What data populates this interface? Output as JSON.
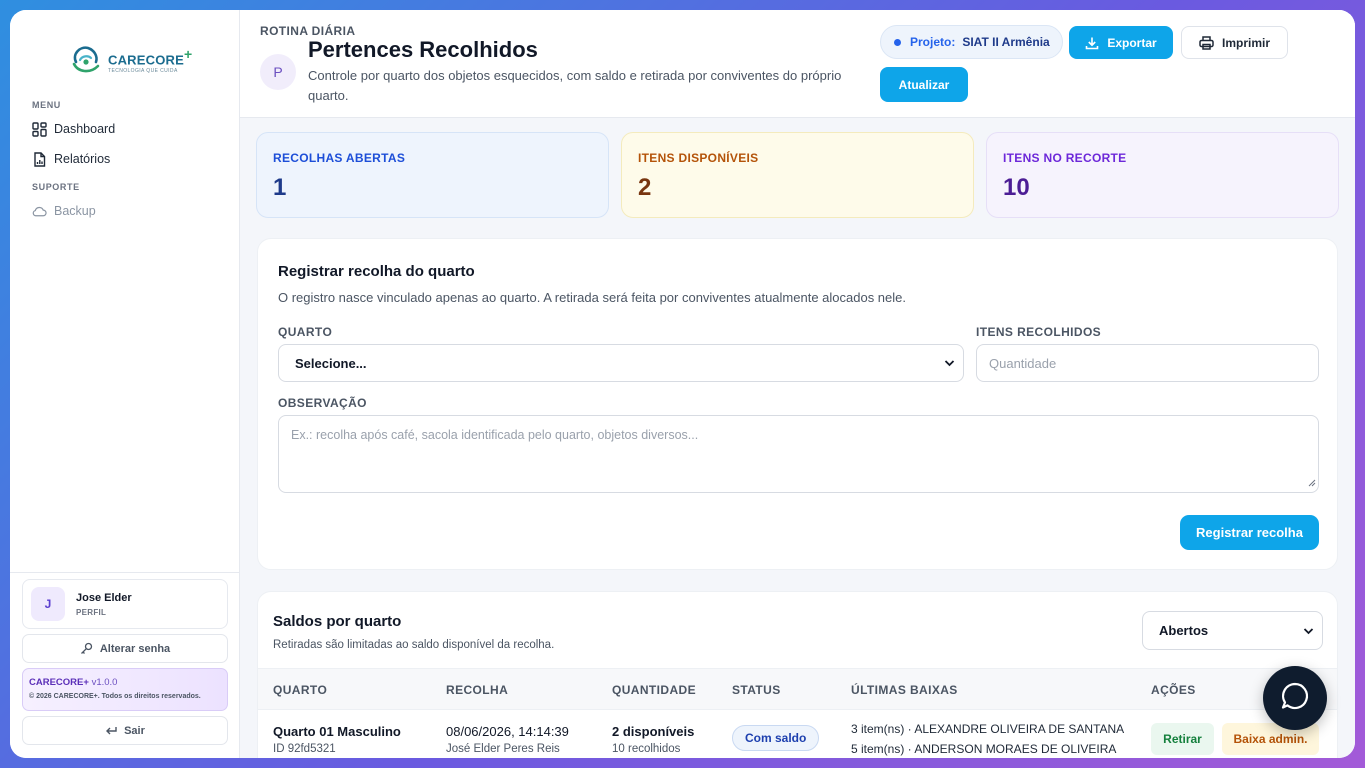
{
  "brand": {
    "name": "CARECORE",
    "plus": "+",
    "tagline": "TECNOLOGIA QUE CUIDA"
  },
  "sidebar": {
    "menu_title": "MENU",
    "items": [
      {
        "label": "Dashboard",
        "icon": "dashboard-grid-icon"
      },
      {
        "label": "Relatórios",
        "icon": "report-file-icon"
      }
    ],
    "support_title": "SUPORTE",
    "support_items": [
      {
        "label": "Backup",
        "icon": "cloud-icon"
      }
    ],
    "profile": {
      "initial": "J",
      "name": "Jose Elder",
      "role": "PERFIL"
    },
    "change_password": "Alterar senha",
    "version": {
      "name": "CARECORE+",
      "number": "v1.0.0",
      "copyright": "© 2026 CARECORE+. Todos os direitos reservados."
    },
    "logout": "Sair"
  },
  "header": {
    "eyebrow": "ROTINA DIÁRIA",
    "icon_letter": "P",
    "title": "Pertences Recolhidos",
    "description": "Controle por quarto dos objetos esquecidos, com saldo e retirada por conviventes do próprio quarto.",
    "project_label": "Projeto:",
    "project_name": "SIAT II Armênia",
    "export_label": "Exportar",
    "print_label": "Imprimir",
    "refresh_label": "Atualizar"
  },
  "stats": [
    {
      "label": "RECOLHAS ABERTAS",
      "value": "1"
    },
    {
      "label": "ITENS DISPONÍVEIS",
      "value": "2"
    },
    {
      "label": "ITENS NO RECORTE",
      "value": "10"
    }
  ],
  "form": {
    "title": "Registrar recolha do quarto",
    "subtitle": "O registro nasce vinculado apenas ao quarto. A retirada será feita por conviventes atualmente alocados nele.",
    "room_label": "QUARTO",
    "room_value": "Selecione...",
    "items_label": "ITENS RECOLHIDOS",
    "items_placeholder": "Quantidade",
    "note_label": "OBSERVAÇÃO",
    "note_placeholder": "Ex.: recolha após café, sacola identificada pelo quarto, objetos diversos...",
    "submit_label": "Registrar recolha"
  },
  "balances": {
    "title": "Saldos por quarto",
    "subtitle": "Retiradas são limitadas ao saldo disponível da recolha.",
    "filter_value": "Abertos",
    "columns": [
      "QUARTO",
      "RECOLHA",
      "QUANTIDADE",
      "STATUS",
      "ÚLTIMAS BAIXAS",
      "AÇÕES"
    ],
    "rows": [
      {
        "room": "Quarto 01 Masculino",
        "room_id": "ID 92fd5321",
        "collected_at": "08/06/2026, 14:14:39",
        "collected_by": "José Elder Peres Reis",
        "available": "2 disponíveis",
        "total": "10 recolhidos",
        "status": "Com saldo",
        "withdrawals": [
          "3 item(ns) · ALEXANDRE OLIVEIRA DE SANTANA",
          "5 item(ns) · ANDERSON MORAES DE OLIVEIRA"
        ],
        "action_withdraw": "Retirar",
        "action_admin": "Baixa admin."
      }
    ]
  }
}
